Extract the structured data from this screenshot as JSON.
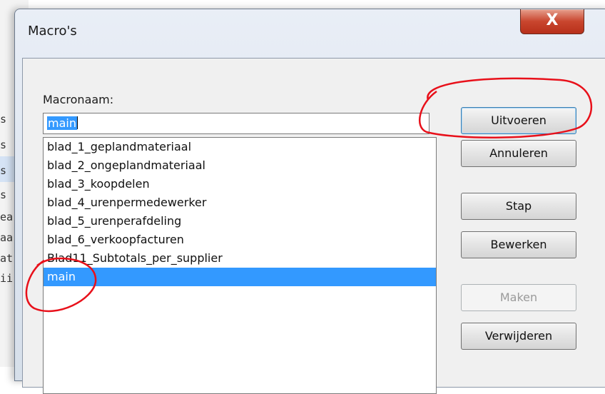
{
  "background": {
    "fragments": [
      "s",
      "s",
      "s",
      "s",
      "ea",
      "aa",
      "at",
      "ii"
    ]
  },
  "dialog": {
    "title": "Macro's",
    "close_label": "X"
  },
  "macro_name": {
    "label": "Macronaam:",
    "value": "main"
  },
  "macros": [
    "blad_1_geplandmateriaal",
    "blad_2_ongeplandmateriaal",
    "blad_3_koopdelen",
    "blad_4_urenpermedewerker",
    "blad_5_urenperafdeling",
    "blad_6_verkoopfacturen",
    "Blad11_Subtotals_per_supplier",
    "main"
  ],
  "selected_macro": "main",
  "buttons": {
    "run": "Uitvoeren",
    "cancel": "Annuleren",
    "step": "Stap",
    "edit": "Bewerken",
    "create": "Maken",
    "delete": "Verwijderen"
  },
  "colors": {
    "selection": "#3399ff",
    "annotation": "#e8101a",
    "close_button": "#c9462e"
  }
}
